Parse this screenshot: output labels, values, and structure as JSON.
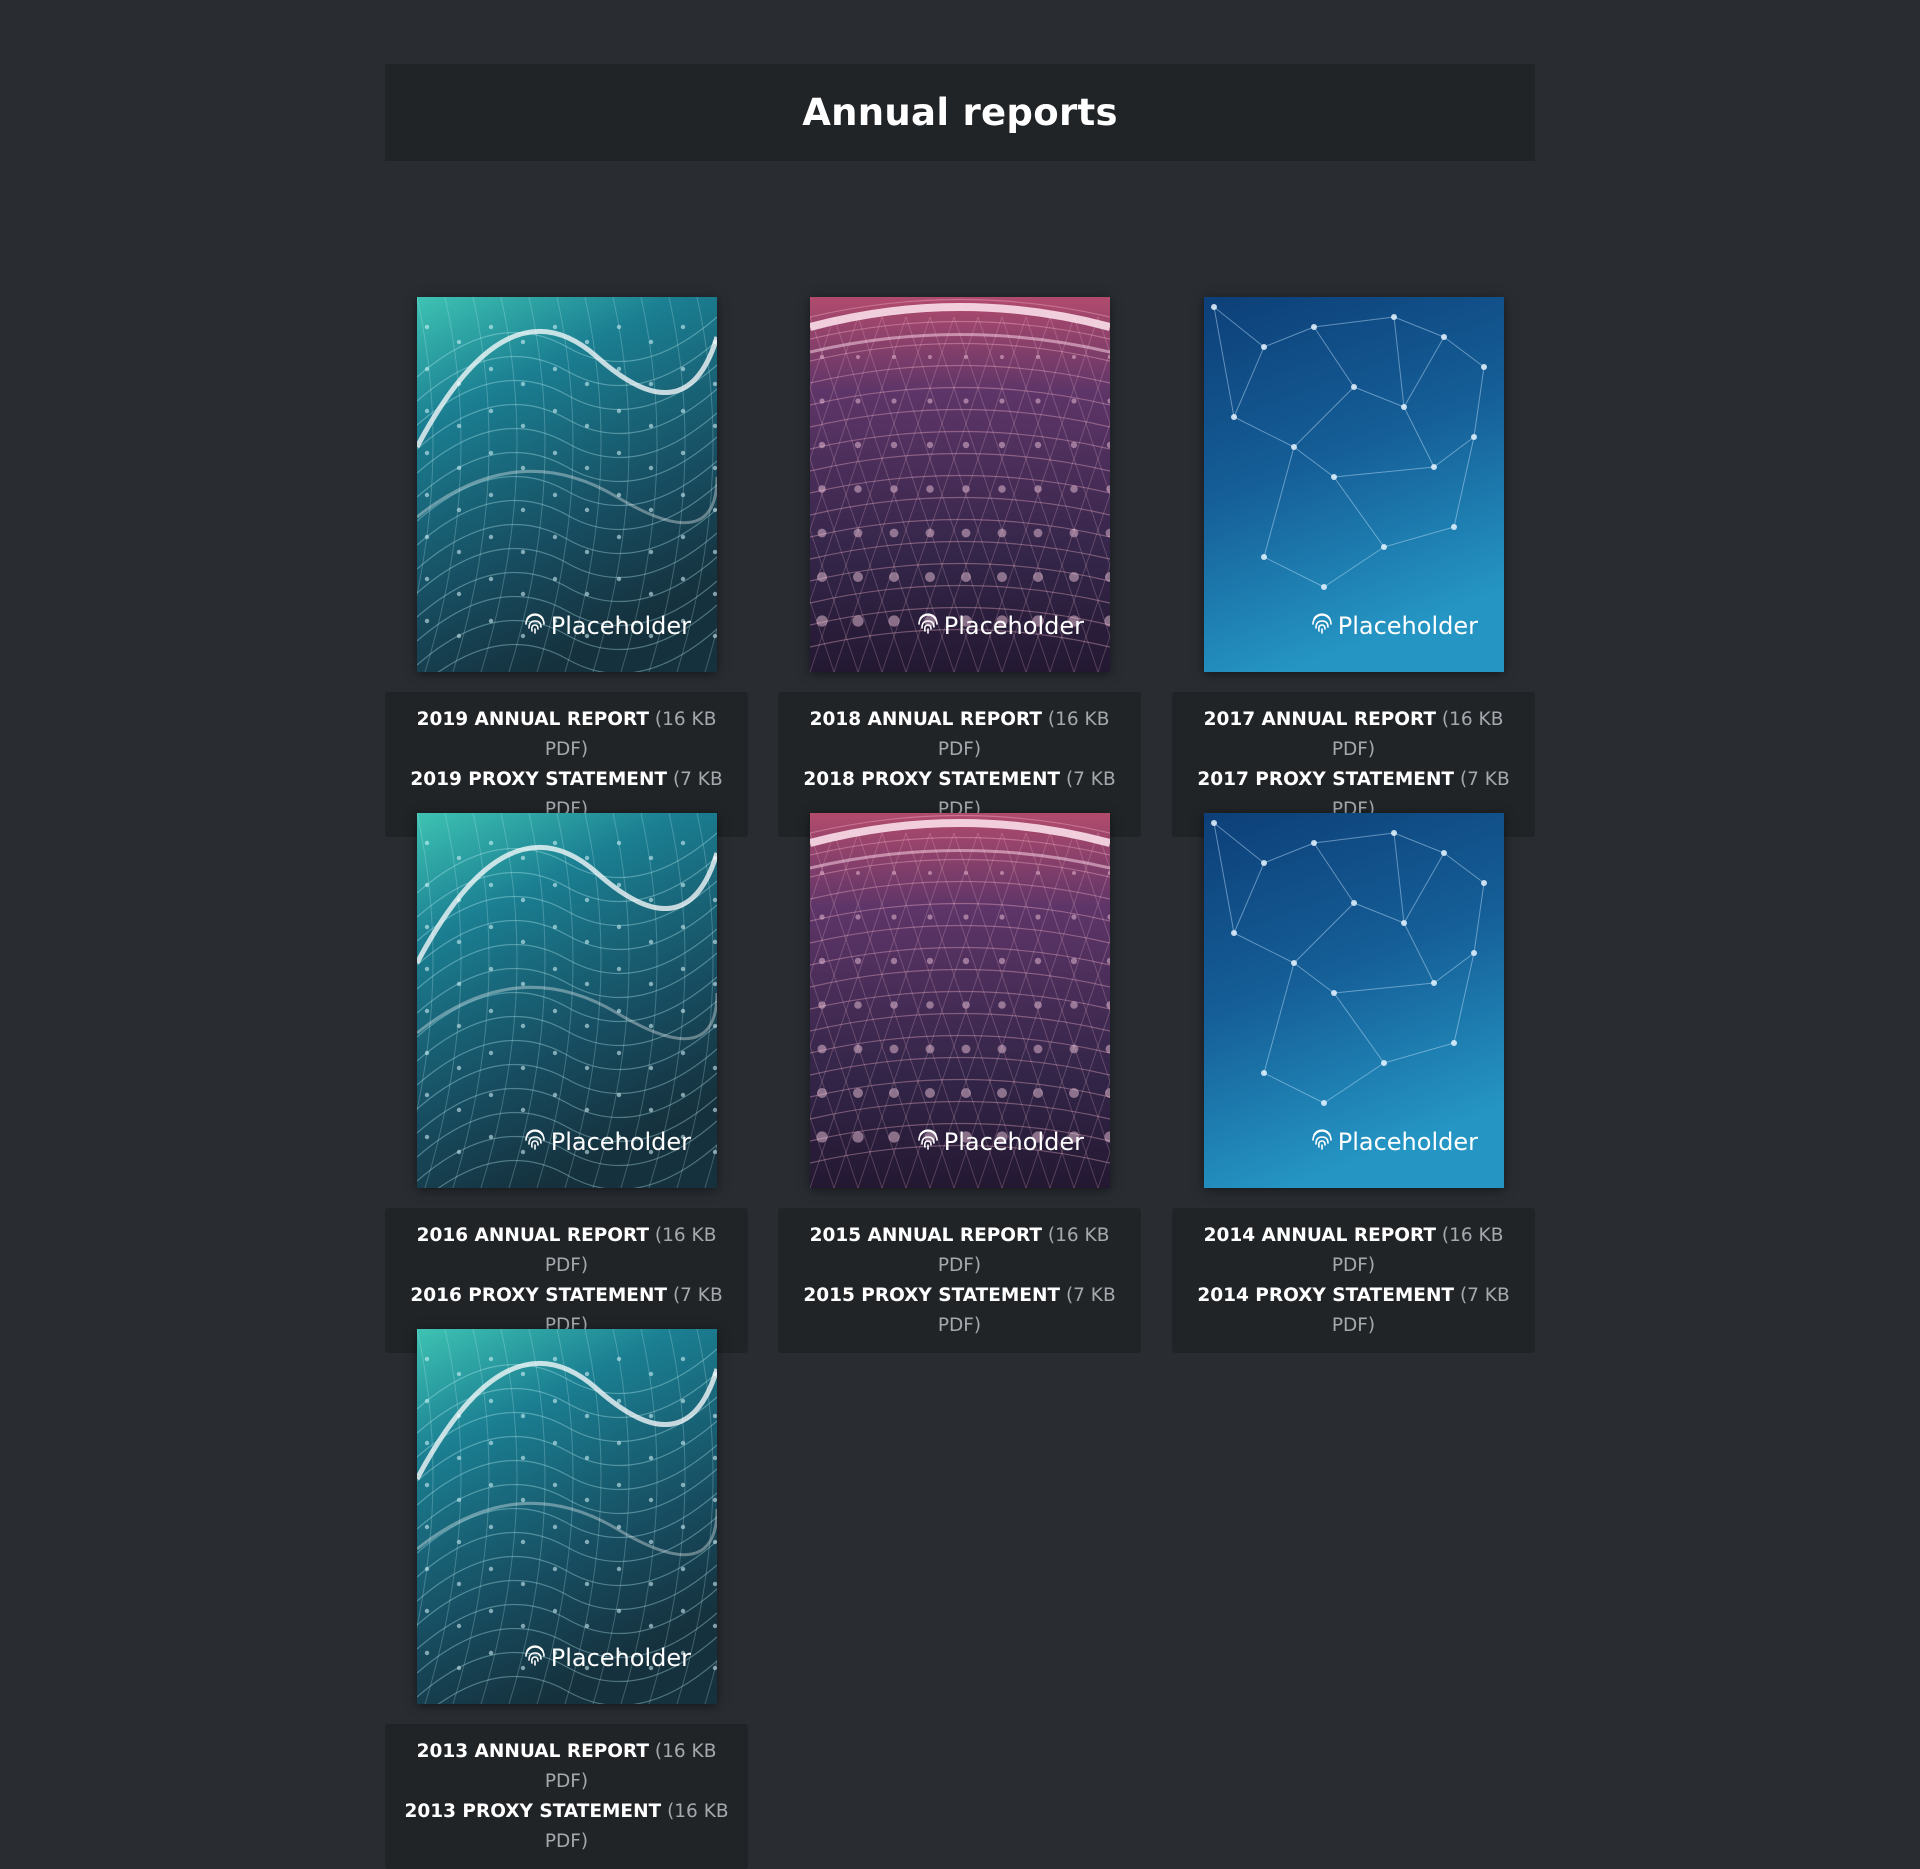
{
  "page": {
    "title": "Annual reports"
  },
  "colors": {
    "background": "#292d32",
    "panel": "#212427",
    "text": "#ffffff",
    "muted": "#a5a9ae"
  },
  "reports": [
    {
      "year": "2019",
      "cover_style": "teal-wave",
      "brand": "Placeholder",
      "annual_label": "2019 ANNUAL REPORT",
      "annual_size": "(16 KB PDF)",
      "proxy_label": "2019 PROXY STATEMENT",
      "proxy_size": "(7 KB PDF)"
    },
    {
      "year": "2018",
      "cover_style": "purple-mesh",
      "brand": "Placeholder",
      "annual_label": "2018 ANNUAL REPORT",
      "annual_size": "(16 KB PDF)",
      "proxy_label": "2018 PROXY STATEMENT",
      "proxy_size": "(7 KB PDF)"
    },
    {
      "year": "2017",
      "cover_style": "blue-network",
      "brand": "Placeholder",
      "annual_label": "2017 ANNUAL REPORT",
      "annual_size": "(16 KB PDF)",
      "proxy_label": "2017 PROXY STATEMENT",
      "proxy_size": "(7 KB PDF)"
    },
    {
      "year": "2016",
      "cover_style": "teal-wave",
      "brand": "Placeholder",
      "annual_label": "2016 ANNUAL REPORT",
      "annual_size": "(16 KB PDF)",
      "proxy_label": "2016 PROXY STATEMENT",
      "proxy_size": "(7 KB PDF)"
    },
    {
      "year": "2015",
      "cover_style": "purple-mesh",
      "brand": "Placeholder",
      "annual_label": "2015 ANNUAL REPORT",
      "annual_size": "(16 KB PDF)",
      "proxy_label": "2015 PROXY STATEMENT",
      "proxy_size": "(7 KB PDF)"
    },
    {
      "year": "2014",
      "cover_style": "blue-network",
      "brand": "Placeholder",
      "annual_label": "2014 ANNUAL REPORT",
      "annual_size": "(16 KB PDF)",
      "proxy_label": "2014 PROXY STATEMENT",
      "proxy_size": "(7 KB PDF)"
    },
    {
      "year": "2013",
      "cover_style": "teal-wave",
      "brand": "Placeholder",
      "annual_label": "2013 ANNUAL REPORT",
      "annual_size": "(16 KB PDF)",
      "proxy_label": "2013 PROXY STATEMENT",
      "proxy_size": "(16 KB PDF)"
    }
  ]
}
